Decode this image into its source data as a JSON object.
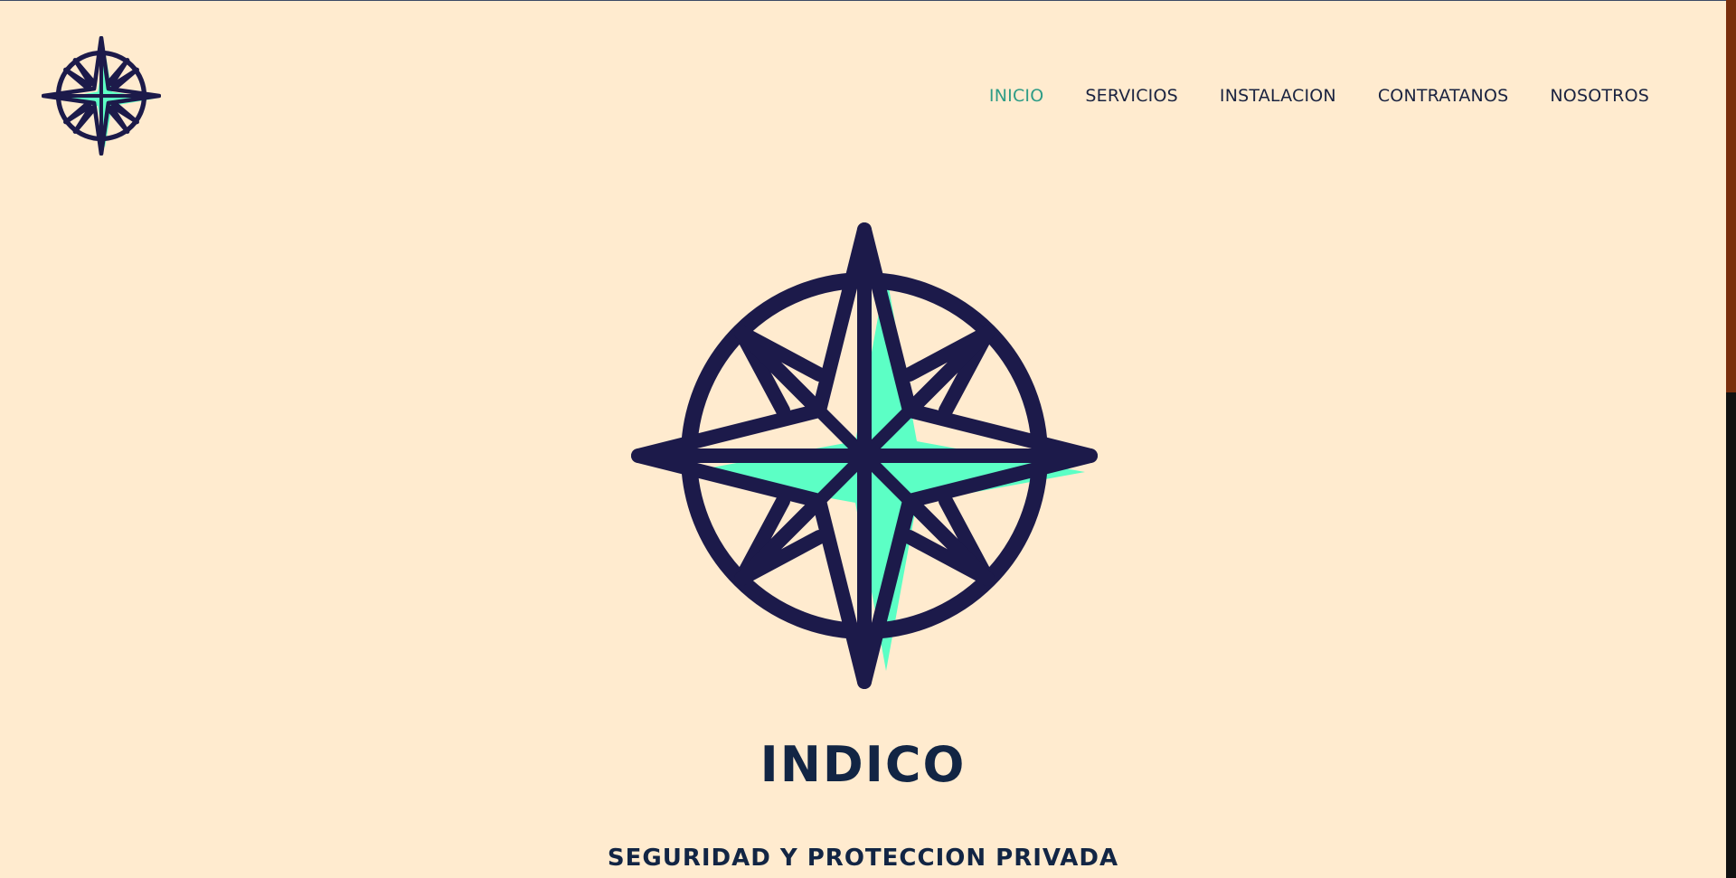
{
  "nav": {
    "items": [
      {
        "label": "INICIO",
        "active": true
      },
      {
        "label": "SERVICIOS",
        "active": false
      },
      {
        "label": "INSTALACION",
        "active": false
      },
      {
        "label": "CONTRATANOS",
        "active": false
      },
      {
        "label": "NOSOTROS",
        "active": false
      }
    ]
  },
  "hero": {
    "title": "INDICO",
    "subtitle": "SEGURIDAD Y PROTECCION PRIVADA",
    "icon": "compass-rose-icon"
  },
  "logo": {
    "icon": "compass-rose-icon"
  },
  "colors": {
    "background": "#ffebcf",
    "primary": "#1c1a4a",
    "accent": "#5cffc5",
    "active_nav": "#2e9c86",
    "text": "#122544",
    "scrollbar_thumb": "#7a2e0c"
  }
}
